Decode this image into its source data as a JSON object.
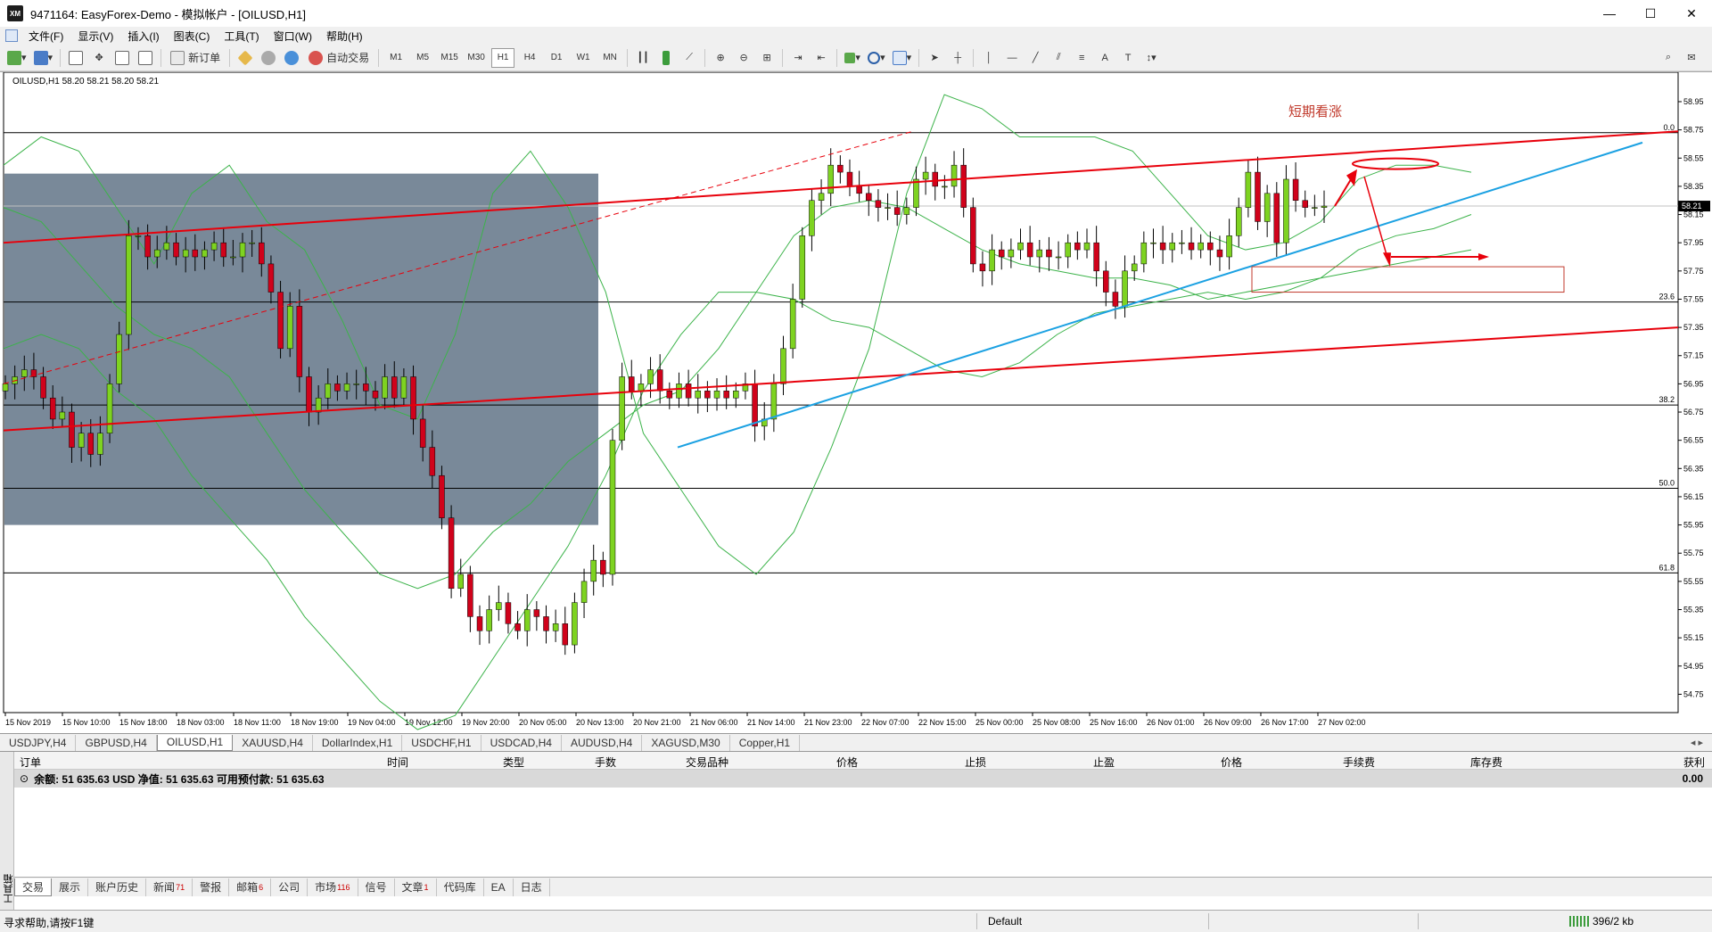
{
  "window": {
    "app_logo": "XM",
    "title": "9471164: EasyForex-Demo - 模拟帐户 - [OILUSD,H1]",
    "controls": [
      "—",
      "☐",
      "✕"
    ]
  },
  "menu": [
    "文件(F)",
    "显示(V)",
    "插入(I)",
    "图表(C)",
    "工具(T)",
    "窗口(W)",
    "帮助(H)"
  ],
  "toolbar": {
    "new_order": "新订单",
    "auto_trade": "自动交易",
    "timeframes": [
      "M1",
      "M5",
      "M15",
      "M30",
      "H1",
      "H4",
      "D1",
      "W1",
      "MN"
    ],
    "active_timeframe": "H1"
  },
  "chart": {
    "symbol_info": "OILUSD,H1  58.20 58.21 58.20 58.21",
    "annotation": "短期看涨",
    "current_price": "58.21",
    "price_ticks": [
      "58.95",
      "58.75",
      "58.55",
      "58.35",
      "58.15",
      "57.95",
      "57.75",
      "57.55",
      "57.35",
      "57.15",
      "56.95",
      "56.75",
      "56.55",
      "56.35",
      "56.15",
      "55.95",
      "55.75",
      "55.55",
      "55.35",
      "55.15",
      "54.95",
      "54.75"
    ],
    "fib_levels": [
      {
        "label": "0.0",
        "price": 58.73
      },
      {
        "label": "23.6",
        "price": 57.53
      },
      {
        "label": "38.2",
        "price": 56.8
      },
      {
        "label": "50.0",
        "price": 56.21
      },
      {
        "label": "61.8",
        "price": 55.61
      }
    ],
    "time_labels": [
      "15 Nov 2019",
      "15 Nov 10:00",
      "15 Nov 18:00",
      "18 Nov 03:00",
      "18 Nov 11:00",
      "18 Nov 19:00",
      "19 Nov 04:00",
      "19 Nov 12:00",
      "19 Nov 20:00",
      "20 Nov 05:00",
      "20 Nov 13:00",
      "20 Nov 21:00",
      "21 Nov 06:00",
      "21 Nov 14:00",
      "21 Nov 23:00",
      "22 Nov 07:00",
      "22 Nov 15:00",
      "25 Nov 00:00",
      "25 Nov 08:00",
      "25 Nov 16:00",
      "26 Nov 01:00",
      "26 Nov 09:00",
      "26 Nov 17:00",
      "27 Nov 02:00"
    ],
    "colors": {
      "bull": "#7ed321",
      "bear": "#d0021b",
      "channel": "#e8000b",
      "trend": "#1ba1e2",
      "bands": "#3cb34a",
      "shade": "#6e7f90"
    },
    "candles": [
      56.95,
      57.0,
      57.05,
      57.0,
      56.85,
      56.7,
      56.75,
      56.5,
      56.6,
      56.45,
      56.6,
      56.95,
      57.3,
      58.0,
      58.0,
      57.85,
      57.9,
      57.95,
      57.85,
      57.9,
      57.85,
      57.9,
      57.95,
      57.85,
      57.85,
      57.95,
      57.95,
      57.8,
      57.6,
      57.2,
      57.5,
      57.0,
      56.75,
      56.85,
      56.95,
      56.9,
      56.95,
      56.95,
      56.9,
      56.85,
      57.0,
      56.85,
      57.0,
      56.7,
      56.5,
      56.3,
      56.0,
      55.5,
      55.6,
      55.3,
      55.2,
      55.35,
      55.4,
      55.25,
      55.2,
      55.35,
      55.3,
      55.2,
      55.25,
      55.1,
      55.4,
      55.55,
      55.7,
      55.6,
      56.55,
      57.0,
      56.9,
      56.95,
      57.05,
      56.9,
      56.85,
      56.95,
      56.85,
      56.9,
      56.85,
      56.9,
      56.85,
      56.9,
      56.95,
      56.65,
      56.7,
      56.95,
      57.2,
      57.55,
      58.0,
      58.25,
      58.3,
      58.5,
      58.45,
      58.35,
      58.3,
      58.25,
      58.2,
      58.2,
      58.15,
      58.2,
      58.4,
      58.45,
      58.35,
      58.35,
      58.5,
      58.2,
      57.8,
      57.75,
      57.9,
      57.85,
      57.9,
      57.95,
      57.85,
      57.9,
      57.85,
      57.85,
      57.95,
      57.9,
      57.95,
      57.75,
      57.6,
      57.5,
      57.75,
      57.8,
      57.95,
      57.95,
      57.9,
      57.95,
      57.95,
      57.9,
      57.95,
      57.9,
      57.85,
      58.0,
      58.2,
      58.45,
      58.1,
      58.3,
      57.95,
      58.4,
      58.25,
      58.2,
      58.2,
      58.21
    ],
    "band_upper": [
      58.5,
      58.7,
      58.6,
      58.2,
      57.8,
      58.3,
      58.5,
      58.1,
      57.9,
      57.4,
      56.8,
      56.7,
      57.3,
      58.3,
      58.6,
      58.2,
      57.6,
      56.6,
      56.2,
      55.8,
      55.6,
      55.9,
      56.5,
      57.2,
      58.3,
      59.0,
      58.9,
      58.7,
      58.7,
      58.7,
      58.6,
      58.3,
      58.0,
      57.9,
      57.95,
      58.1,
      58.4,
      58.5,
      58.5,
      58.45
    ],
    "band_mid": [
      58.2,
      58.1,
      57.8,
      57.5,
      57.3,
      57.2,
      57.0,
      56.6,
      56.2,
      55.9,
      55.6,
      55.5,
      55.6,
      55.9,
      56.1,
      56.4,
      56.6,
      56.8,
      56.9,
      57.2,
      57.6,
      58.0,
      58.2,
      58.25,
      58.2,
      58.05,
      57.9,
      57.8,
      57.75,
      57.7,
      57.7,
      57.65,
      57.55,
      57.6,
      57.65,
      57.7,
      57.9,
      58.0,
      58.05,
      58.15
    ],
    "band_lower": [
      57.2,
      57.3,
      57.2,
      56.9,
      56.7,
      56.3,
      56.0,
      55.7,
      55.3,
      55.0,
      54.7,
      54.5,
      54.6,
      55.0,
      55.4,
      55.8,
      56.3,
      56.9,
      57.3,
      57.6,
      57.6,
      57.55,
      57.4,
      57.35,
      57.2,
      57.05,
      57.0,
      57.1,
      57.3,
      57.45,
      57.5,
      57.55,
      57.6,
      57.55,
      57.6,
      57.7,
      57.75,
      57.8,
      57.85,
      57.9
    ]
  },
  "chart_tabs": [
    "USDJPY,H4",
    "GBPUSD,H4",
    "OILUSD,H1",
    "XAUUSD,H4",
    "DollarIndex,H1",
    "USDCHF,H1",
    "USDCAD,H4",
    "AUDUSD,H4",
    "XAGUSD,M30",
    "Copper,H1"
  ],
  "active_chart_tab": "OILUSD,H1",
  "terminal": {
    "side_label": "工具箱",
    "columns": [
      "订单",
      "时间",
      "类型",
      "手数",
      "交易品种",
      "价格",
      "止损",
      "止盈",
      "价格",
      "手续费",
      "库存费",
      "获利"
    ],
    "balance_row": "余额: 51 635.63 USD  净值: 51 635.63  可用预付款: 51 635.63",
    "profit_total": "0.00",
    "tabs": [
      {
        "label": "交易",
        "badge": ""
      },
      {
        "label": "展示",
        "badge": ""
      },
      {
        "label": "账户历史",
        "badge": ""
      },
      {
        "label": "新闻",
        "badge": "71"
      },
      {
        "label": "警报",
        "badge": ""
      },
      {
        "label": "邮箱",
        "badge": "6"
      },
      {
        "label": "公司",
        "badge": ""
      },
      {
        "label": "市场",
        "badge": "116"
      },
      {
        "label": "信号",
        "badge": ""
      },
      {
        "label": "文章",
        "badge": "1"
      },
      {
        "label": "代码库",
        "badge": ""
      },
      {
        "label": "EA",
        "badge": ""
      },
      {
        "label": "日志",
        "badge": ""
      }
    ]
  },
  "status": {
    "help": "寻求帮助,请按F1键",
    "profile": "Default",
    "traffic": "396/2 kb"
  }
}
